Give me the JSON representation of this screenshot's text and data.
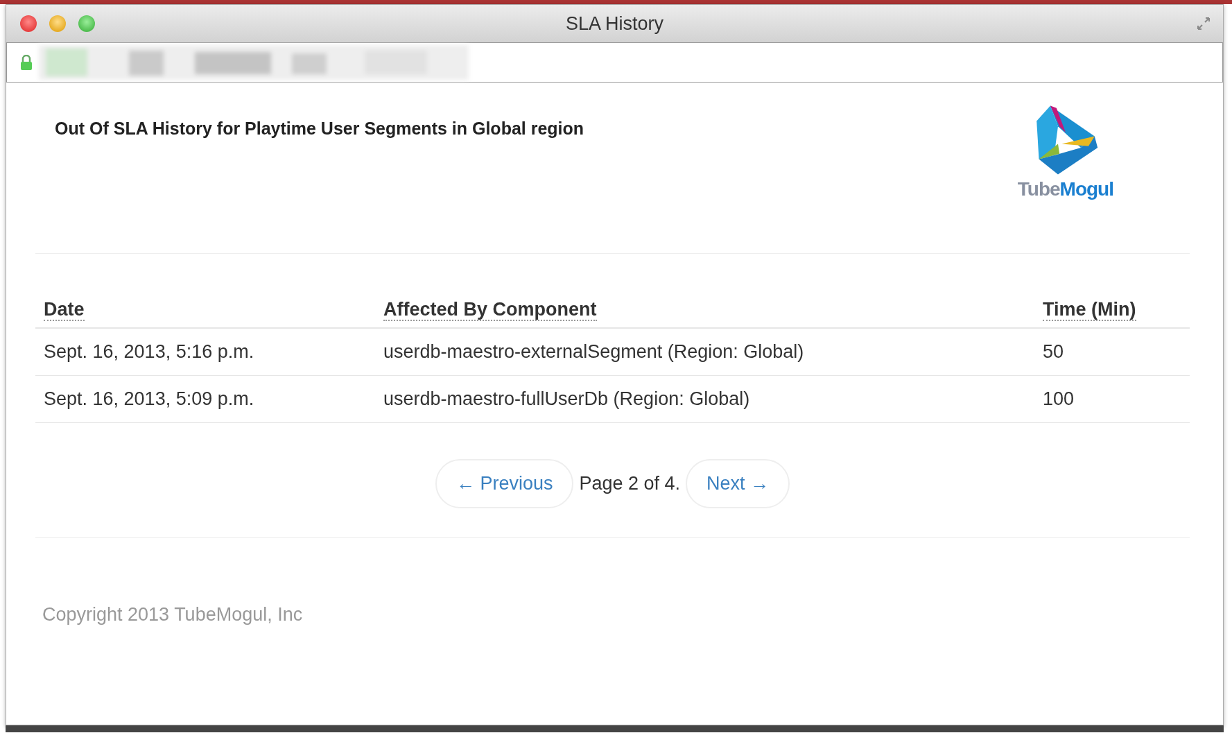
{
  "window": {
    "title": "SLA History"
  },
  "page": {
    "heading": "Out Of SLA History for Playtime User Segments in Global region",
    "logo": {
      "text_a": "Tube",
      "text_b": "Mogul"
    }
  },
  "table": {
    "columns": [
      "Date",
      "Affected By Component",
      "Time (Min)"
    ],
    "rows": [
      [
        "Sept. 16, 2013, 5:16 p.m.",
        "userdb-maestro-externalSegment (Region: Global)",
        "50"
      ],
      [
        "Sept. 16, 2013, 5:09 p.m.",
        "userdb-maestro-fullUserDb (Region: Global)",
        "100"
      ]
    ]
  },
  "pagination": {
    "previous": "← Previous",
    "status": "Page 2 of 4.",
    "next": "Next →"
  },
  "footer": {
    "copyright": "Copyright 2013 TubeMogul, Inc"
  }
}
